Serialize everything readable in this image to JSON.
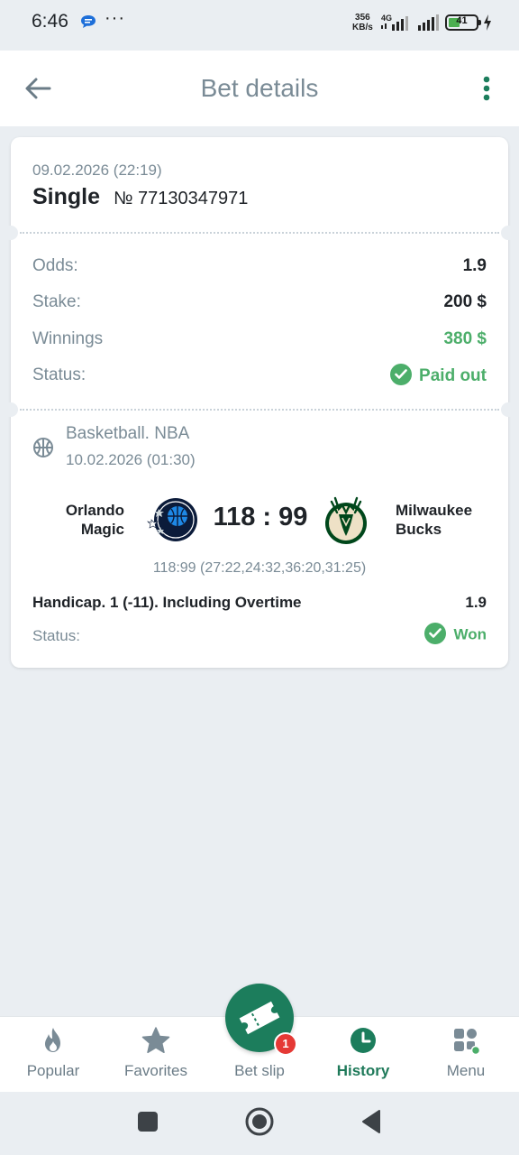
{
  "status_bar": {
    "time": "6:46",
    "overflow": "···",
    "speed_value": "356",
    "speed_unit": "KB/s",
    "network": "4G",
    "battery": "41"
  },
  "header": {
    "title": "Bet details",
    "back_icon": "arrow-left-icon",
    "menu_icon": "more-vertical-icon"
  },
  "bet": {
    "date": "09.02.2026 (22:19)",
    "type": "Single",
    "number": "№ 77130347971",
    "rows": {
      "odds_label": "Odds:",
      "odds_value": "1.9",
      "stake_label": "Stake:",
      "stake_value": "200 $",
      "winnings_label": "Winnings",
      "winnings_value": "380 $",
      "status_label": "Status:",
      "status_value": "Paid out"
    }
  },
  "event": {
    "league": "Basketball. NBA",
    "date": "10.02.2026 (01:30)",
    "team1_line1": "Orlando",
    "team1_line2": "Magic",
    "score": "118 : 99",
    "team2_line1": "Milwaukee",
    "team2_line2": "Bucks",
    "periods": "118:99 (27:22,24:32,36:20,31:25)",
    "market": "Handicap. 1 (-11). Including Overtime",
    "market_odds": "1.9",
    "status_label": "Status:",
    "status_value": "Won"
  },
  "bottom_nav": {
    "items": [
      {
        "label": "Popular",
        "icon": "fire-icon"
      },
      {
        "label": "Favorites",
        "icon": "star-icon"
      },
      {
        "label": "Bet slip",
        "icon": "ticket-icon",
        "badge": "1"
      },
      {
        "label": "History",
        "icon": "clock-icon",
        "active": true
      },
      {
        "label": "Menu",
        "icon": "grid-icon"
      }
    ]
  },
  "colors": {
    "accent": "#1c7d5c",
    "success": "#4cae6a",
    "muted": "#7a8b96",
    "background": "#eaeef2",
    "badge": "#e53935"
  }
}
